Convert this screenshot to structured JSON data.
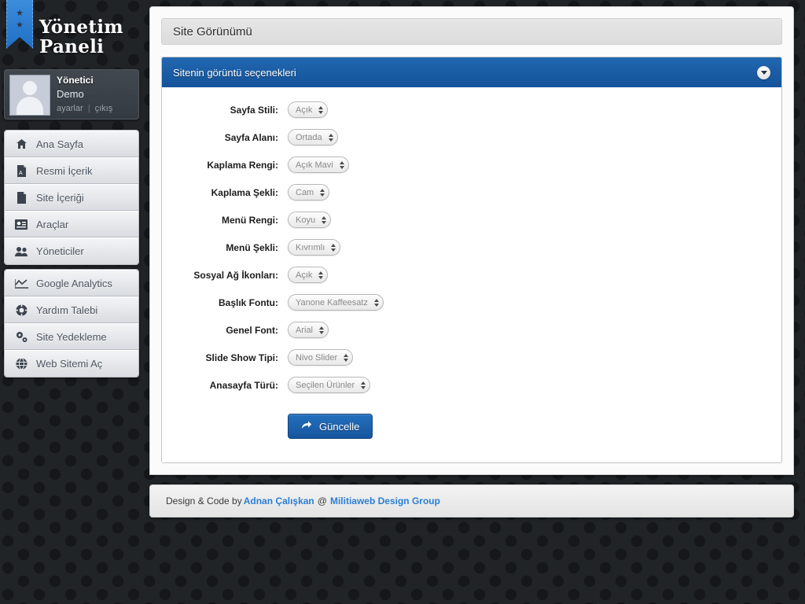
{
  "brand": {
    "line1": "Yönetim",
    "line2": "Paneli",
    "ribbon_star": "★"
  },
  "user": {
    "name": "Yönetici",
    "role": "Demo",
    "settings_link": "ayarlar",
    "logout_link": "çıkış",
    "separator": "|"
  },
  "sidebar": {
    "main_items": [
      {
        "label": "Ana Sayfa",
        "icon": "home-icon"
      },
      {
        "label": "Resmi İçerik",
        "icon": "pdf-icon"
      },
      {
        "label": "Site İçeriği",
        "icon": "document-icon"
      },
      {
        "label": "Araçlar",
        "icon": "tools-icon"
      },
      {
        "label": "Yöneticiler",
        "icon": "users-icon"
      }
    ],
    "tool_items": [
      {
        "label": "Google Analytics",
        "icon": "chart-line-icon"
      },
      {
        "label": "Yardım Talebi",
        "icon": "lifebuoy-icon"
      },
      {
        "label": "Site Yedekleme",
        "icon": "gears-icon"
      },
      {
        "label": "Web Sitemi Aç",
        "icon": "globe-icon"
      }
    ]
  },
  "page": {
    "title": "Site Görünümü"
  },
  "panel": {
    "title": "Sitenin görüntü seçenekleri",
    "collapse_icon": "chevron-down-icon"
  },
  "form": {
    "fields": [
      {
        "label": "Sayfa Stili:",
        "value": "Açık"
      },
      {
        "label": "Sayfa Alanı:",
        "value": "Ortada"
      },
      {
        "label": "Kaplama Rengi:",
        "value": "Açık Mavi"
      },
      {
        "label": "Kaplama Şekli:",
        "value": "Cam"
      },
      {
        "label": "Menü Rengi:",
        "value": "Koyu"
      },
      {
        "label": "Menü Şekli:",
        "value": "Kıvrımlı"
      },
      {
        "label": "Sosyal Ağ İkonları:",
        "value": "Açık"
      },
      {
        "label": "Başlık Fontu:",
        "value": "Yanone Kaffeesatz"
      },
      {
        "label": "Genel Font:",
        "value": "Arial"
      },
      {
        "label": "Slide Show Tipi:",
        "value": "Nivo Slider"
      },
      {
        "label": "Anasayfa Türü:",
        "value": "Seçilen Ürünler"
      }
    ],
    "submit_label": "Güncelle",
    "submit_icon": "arrow-forward-icon"
  },
  "footer": {
    "prefix": "Design & Code by",
    "author": "Adnan Çalışkan",
    "at": "@",
    "company": "Militiaweb Design Group"
  },
  "colors": {
    "accent_blue": "#1b5fa8",
    "link_blue": "#2a7fd4",
    "sidebar_dark": "#1b1d20"
  }
}
